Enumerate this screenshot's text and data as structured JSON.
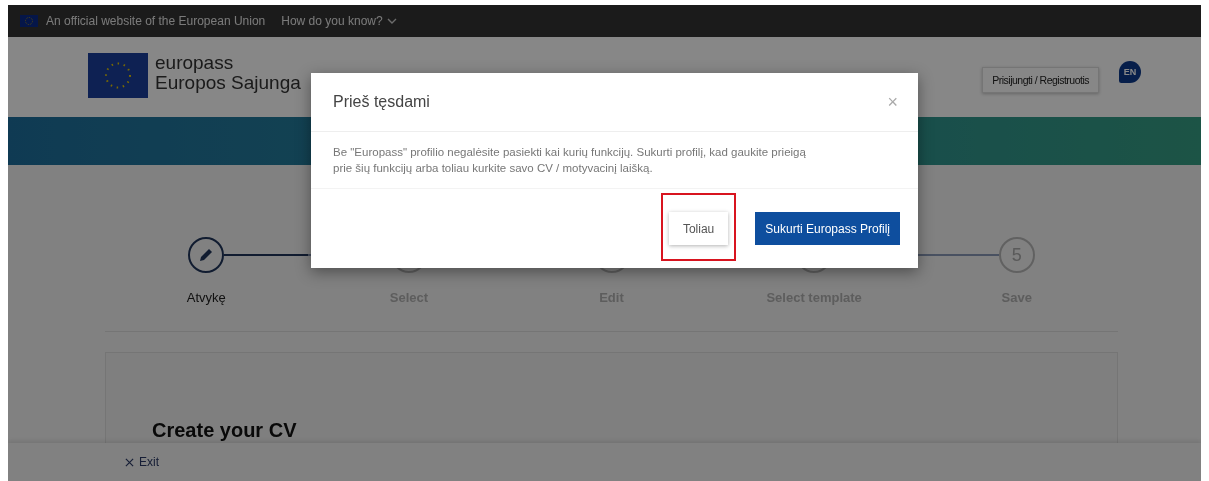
{
  "gov_bar": {
    "text": "An official website of the European Union",
    "link": "How do you know?"
  },
  "header": {
    "brand": "europass",
    "subtitle": "Europos Sajunga",
    "login": "Prisijungti / Registruotis",
    "language": "EN"
  },
  "steps": [
    {
      "kind": "icon",
      "label": "Atvykę",
      "selected": true
    },
    {
      "kind": "number",
      "label": "Select",
      "selected": false
    },
    {
      "kind": "number",
      "label": "Edit",
      "selected": false
    },
    {
      "kind": "number",
      "label": "Select template",
      "selected": false
    },
    {
      "kind": "number",
      "number": "5",
      "label": "Save",
      "selected": false
    }
  ],
  "card": {
    "title": "Create your CV"
  },
  "footer": {
    "exit": "Exit"
  },
  "modal": {
    "title": "Prieš tęsdami",
    "close": "×",
    "message": "Be \"Europass\" profilio negalėsite pasiekti kai kurių funkcijų. Sukurti profilį, kad gaukite prieigą prie šių funkcijų arba toliau kurkite savo CV / motyvacinį laišką.",
    "buttons": [
      {
        "label": "Toliau",
        "kind": "secondary",
        "highlighted": true
      },
      {
        "label": "Sukurti Europass Profilį",
        "kind": "primary",
        "highlighted": false
      }
    ]
  }
}
